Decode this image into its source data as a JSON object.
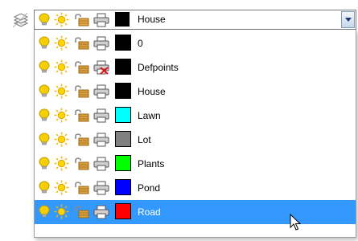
{
  "combo": {
    "selected": {
      "name": "House",
      "color": "#000000",
      "plot": "on"
    }
  },
  "layers": [
    {
      "name": "0",
      "color": "#000000",
      "plot": "on"
    },
    {
      "name": "Defpoints",
      "color": "#000000",
      "plot": "off"
    },
    {
      "name": "House",
      "color": "#000000",
      "plot": "on"
    },
    {
      "name": "Lawn",
      "color": "#00ffff",
      "plot": "on"
    },
    {
      "name": "Lot",
      "color": "#808080",
      "plot": "on"
    },
    {
      "name": "Plants",
      "color": "#00ff00",
      "plot": "on"
    },
    {
      "name": "Pond",
      "color": "#0000ff",
      "plot": "on"
    },
    {
      "name": "Road",
      "color": "#ff0000",
      "plot": "on",
      "selected": true
    }
  ],
  "icons": {
    "layers_tool": "layers-icon",
    "on_off": "lightbulb-icon",
    "freeze": "sun-icon",
    "lock": "padlock-icon",
    "plot": "printer-icon",
    "no_plot": "printer-disabled-icon",
    "dropdown": "chevron-down-icon",
    "cursor": "mouse-pointer-icon"
  },
  "colors": {
    "selection": "#3399ff",
    "bulb": "#f4d000",
    "sun": "#ffd700",
    "lock": "#d8a040"
  }
}
